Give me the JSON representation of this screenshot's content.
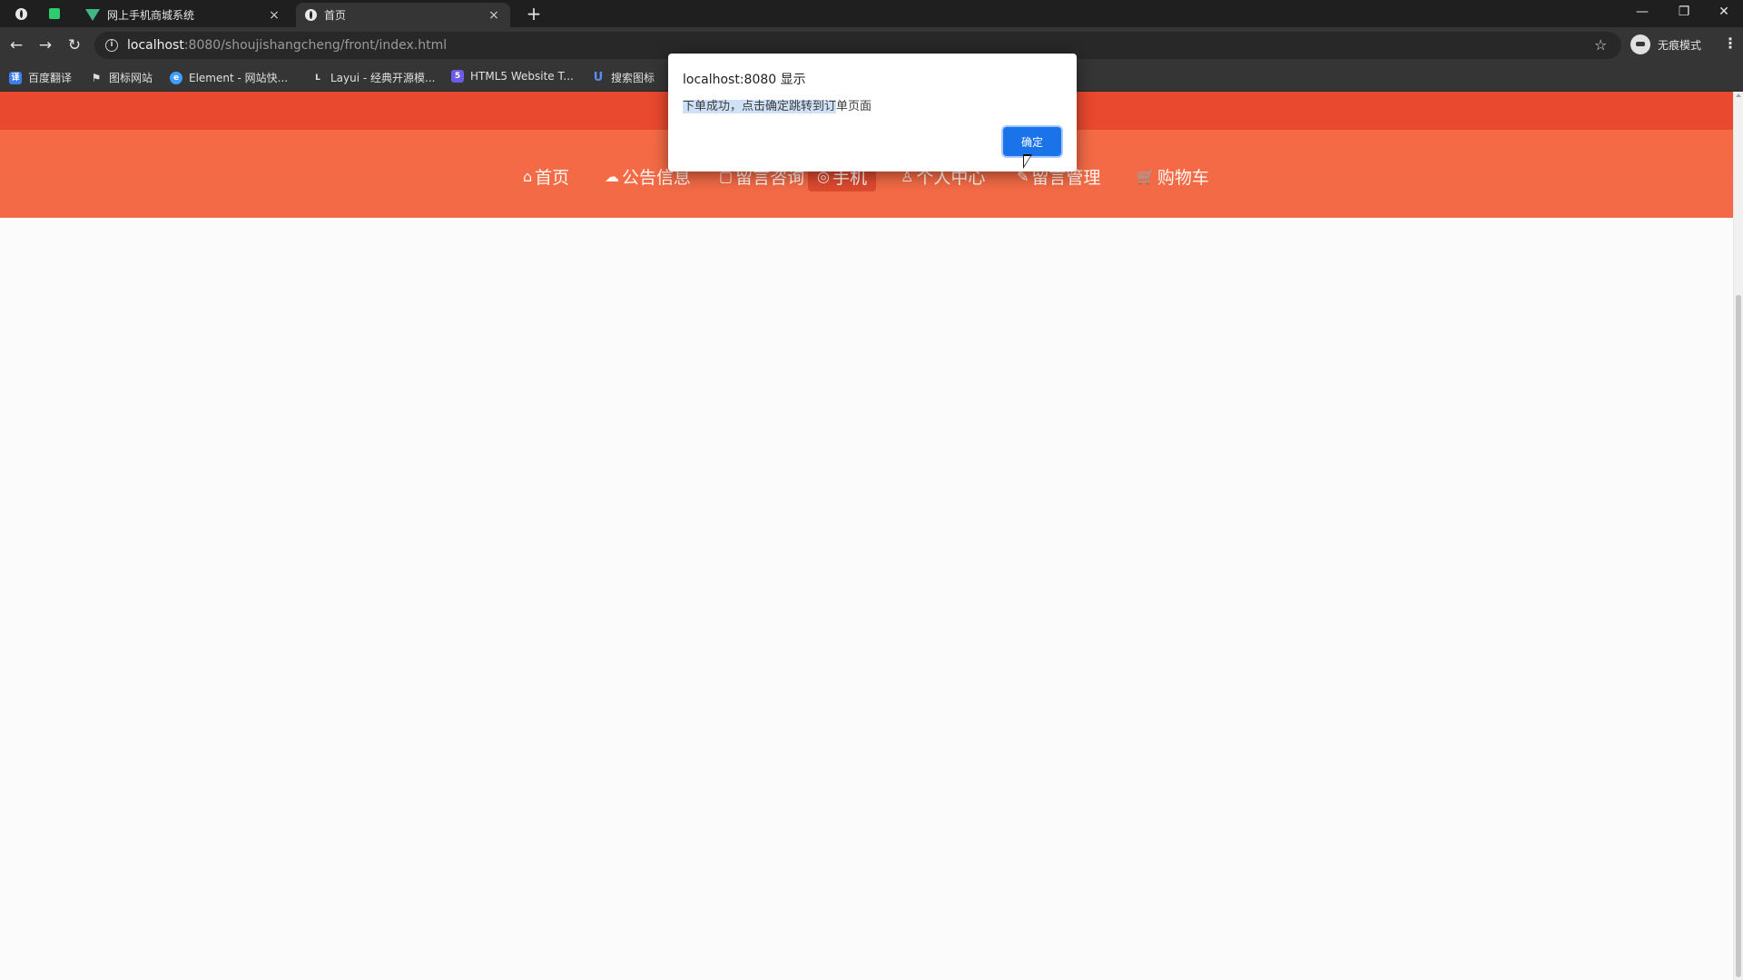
{
  "browser": {
    "tabs": [
      {
        "title": "网上手机商城系统",
        "active": false
      },
      {
        "title": "首页",
        "active": true
      }
    ],
    "new_tab_label": "+",
    "close_glyph": "×",
    "window_controls": {
      "minimize": "—",
      "maximize": "❐",
      "close": "✕"
    },
    "nav": {
      "back": "←",
      "forward": "→",
      "reload": "↻"
    },
    "url": {
      "host": "localhost",
      "path": ":8080/shoujishangcheng/front/index.html"
    },
    "star_glyph": "☆",
    "profile_label": "无痕模式",
    "menu_glyph": "⋮",
    "bookmarks": [
      {
        "label": "百度翻译",
        "icon": "translate-icon",
        "color": "#3d7ef0"
      },
      {
        "label": "图标网站",
        "icon": "flag-icon",
        "color": "#444444"
      },
      {
        "label": "Element - 网站快...",
        "icon": "element-icon",
        "color": "#409eff"
      },
      {
        "label": "Layui - 经典开源模...",
        "icon": "layui-icon",
        "color": "#555555"
      },
      {
        "label": "HTML5 Website T...",
        "icon": "html5-icon",
        "color": "#6c5ce7"
      },
      {
        "label": "搜索图标",
        "icon": "book-icon",
        "color": "#5b8def"
      }
    ]
  },
  "site": {
    "nav": [
      {
        "label": "首页",
        "glyph": "⌂"
      },
      {
        "label": "公告信息",
        "glyph": "☁"
      },
      {
        "label": "留言咨询",
        "glyph": "▢"
      },
      {
        "label": "手机",
        "glyph": "◎",
        "active": true
      },
      {
        "label": "个人中心",
        "glyph": "♙"
      },
      {
        "label": "留言管理",
        "glyph": "✎"
      },
      {
        "label": "购物车",
        "glyph": "🛒"
      }
    ],
    "colors": {
      "top_bar": "#e8492f",
      "nav_bar": "#f56a45",
      "active_item": "#de4a2f"
    }
  },
  "dialog": {
    "title": "localhost:8080 显示",
    "message_highlighted": "下单成功，点击确定跳转到订",
    "message_rest": "单页面",
    "ok_label": "确定",
    "accent": "#1a73e8"
  }
}
